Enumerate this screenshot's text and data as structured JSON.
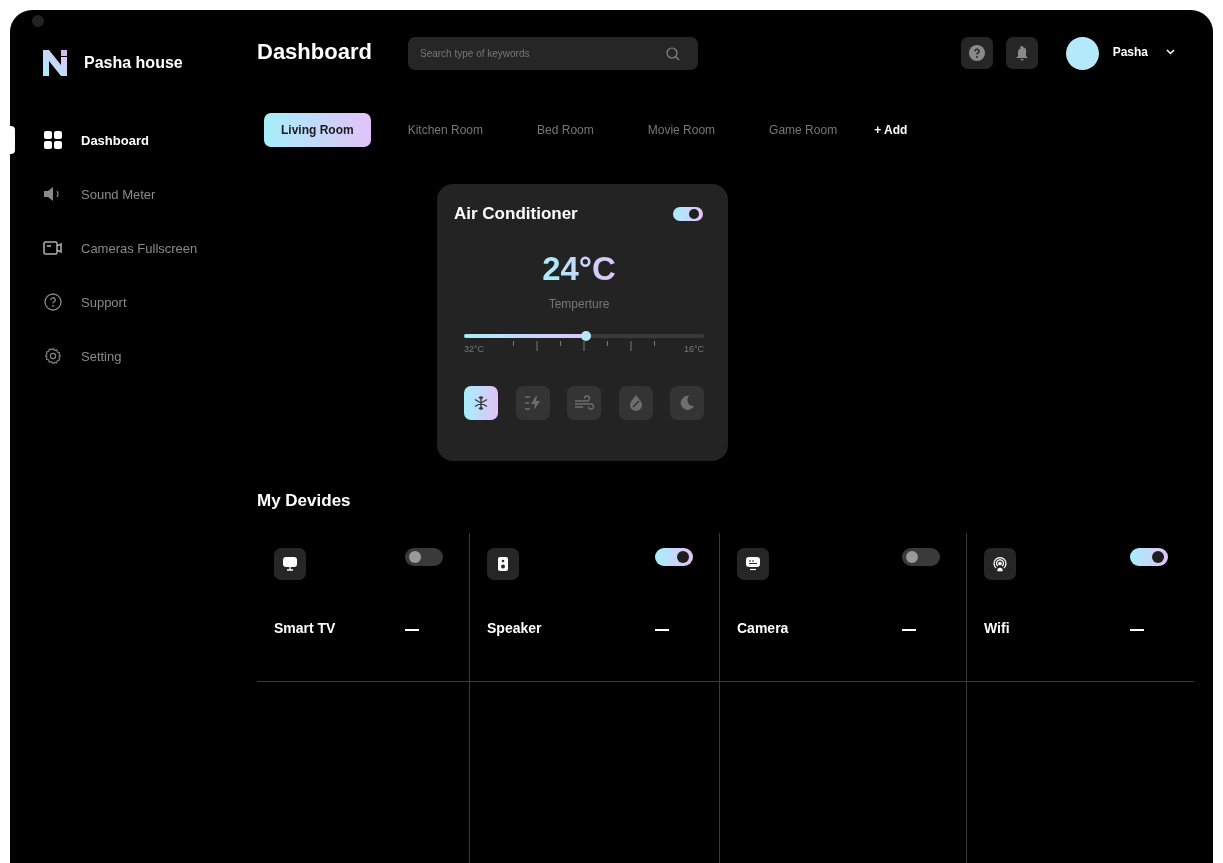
{
  "brand": {
    "name": "Pasha house"
  },
  "sidebar": {
    "items": [
      {
        "label": "Dashboard",
        "kind": "grid",
        "selected": true
      },
      {
        "label": "Sound Meter",
        "kind": "sound",
        "selected": false
      },
      {
        "label": "Cameras Fullscreen",
        "kind": "camera",
        "selected": false
      },
      {
        "label": "Support",
        "kind": "help",
        "selected": false
      },
      {
        "label": "Setting",
        "kind": "gear",
        "selected": false
      }
    ]
  },
  "header": {
    "title": "Dashboard",
    "search": {
      "placeholder": "Search type of keywords"
    },
    "user": {
      "name": "Pasha"
    }
  },
  "rooms": {
    "tabs": [
      {
        "label": "Living Room",
        "selected": true
      },
      {
        "label": "Kitchen Room",
        "selected": false
      },
      {
        "label": "Bed Room",
        "selected": false
      },
      {
        "label": "Movie Room",
        "selected": false
      },
      {
        "label": "Game Room",
        "selected": false
      }
    ],
    "add_button": "+ Add"
  },
  "air_conditioner": {
    "title": "Air Conditioner",
    "on": true,
    "temperature": "24°C",
    "caption": "Temperture",
    "slider": {
      "level": 0.51,
      "min_label": "32°C",
      "max_label": "16°C"
    },
    "modes": [
      {
        "kind": "cool",
        "selected": true
      },
      {
        "kind": "power",
        "selected": false
      },
      {
        "kind": "wind",
        "selected": false
      },
      {
        "kind": "dry",
        "selected": false
      },
      {
        "kind": "night",
        "selected": false
      }
    ]
  },
  "devices": {
    "title": "My Devides",
    "items": [
      {
        "name": "Smart TV",
        "kind": "tv",
        "on": false
      },
      {
        "name": "Speaker",
        "kind": "speaker",
        "on": true
      },
      {
        "name": "Camera",
        "kind": "camera",
        "on": false
      },
      {
        "name": "Wifi",
        "kind": "wifi",
        "on": true
      }
    ]
  }
}
